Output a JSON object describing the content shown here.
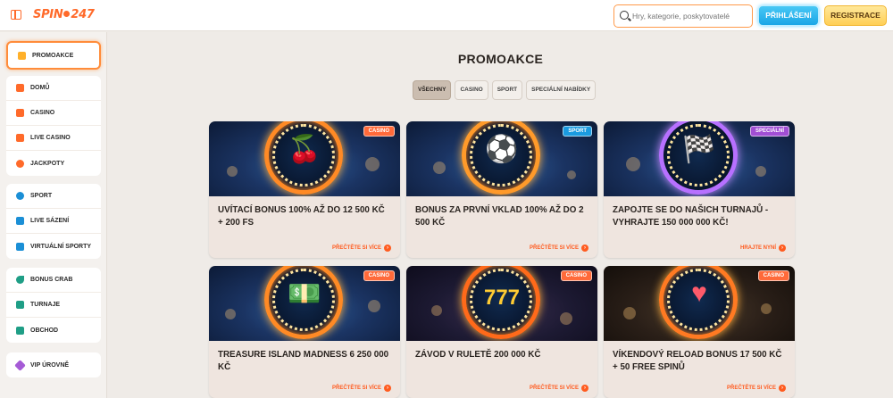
{
  "header": {
    "logo_left": "SPIN",
    "logo_right": "247",
    "search_placeholder": "Hry, kategorie, poskytovatelé",
    "login_label": "PŘIHLÁŠENÍ",
    "register_label": "REGISTRACE"
  },
  "sidebar": {
    "promo": {
      "label": "PROMOAKCE",
      "icon": "gift-icon"
    },
    "group1": [
      {
        "label": "DOMŮ",
        "icon": "home-icon",
        "color": "#ff6a2a"
      },
      {
        "label": "CASINO",
        "icon": "cards-icon",
        "color": "#ff6a2a"
      },
      {
        "label": "LIVE CASINO",
        "icon": "live-casino-icon",
        "color": "#ff6a2a"
      },
      {
        "label": "JACKPOTY",
        "icon": "jackpot-icon",
        "color": "#ff6a2a"
      }
    ],
    "group2": [
      {
        "label": "SPORT",
        "icon": "ball-icon",
        "color": "#1b8fd6"
      },
      {
        "label": "LIVE SÁZENÍ",
        "icon": "live-bet-icon",
        "color": "#1b8fd6"
      },
      {
        "label": "VIRTUÁLNÍ SPORTY",
        "icon": "virtual-sports-icon",
        "color": "#1b8fd6"
      }
    ],
    "group3": [
      {
        "label": "BONUS CRAB",
        "icon": "crab-claw-icon",
        "color": "#1f9e86"
      },
      {
        "label": "TURNAJE",
        "icon": "trophy-icon",
        "color": "#1f9e86"
      },
      {
        "label": "OBCHOD",
        "icon": "shop-icon",
        "color": "#1f9e86"
      }
    ],
    "group4": [
      {
        "label": "VIP ÚROVNĚ",
        "icon": "vip-gem-icon",
        "color": "#a55bd6"
      }
    ]
  },
  "main": {
    "title": "PROMOAKCE",
    "filters": [
      "VŠECHNY",
      "CASINO",
      "SPORT",
      "SPECIÁLNÍ NABÍDKY"
    ],
    "cards": [
      {
        "badge": "CASINO",
        "badge_color": "#ff6a3a",
        "title": "UVÍTACÍ BONUS 100% AŽ DO 12 500 KČ + 200 FS",
        "link": "PŘEČTĚTE SI VÍCE",
        "icon": "cherry-icon"
      },
      {
        "badge": "SPORT",
        "badge_color": "#1b9be0",
        "title": "BONUS ZA PRVNÍ VKLAD 100% AŽ DO 2 500 KČ",
        "link": "PŘEČTĚTE SI VÍCE",
        "icon": "football-icon"
      },
      {
        "badge": "SPECIÁLNÍ",
        "badge_color": "#a14fd4",
        "title": "ZAPOJTE SE DO NAŠICH TURNAJŮ - VYHRAJTE 150 000 000 KČ!",
        "link": "HRAJTE NYNÍ",
        "icon": "race-flags-icon"
      },
      {
        "badge": "CASINO",
        "badge_color": "#ff6a3a",
        "title": "TREASURE ISLAND MADNESS 6 250 000 KČ",
        "link": "PŘEČTĚTE SI VÍCE",
        "icon": "money-stack-icon"
      },
      {
        "badge": "CASINO",
        "badge_color": "#ff6a3a",
        "title": "ZÁVOD V RULETĚ 200 000 KČ",
        "link": "PŘEČTĚTE SI VÍCE",
        "icon": "triple-seven-icon"
      },
      {
        "badge": "CASINO",
        "badge_color": "#ff6a3a",
        "title": "VÍKENDOVÝ RELOAD BONUS 17 500 KČ + 50 FREE SPINŮ",
        "link": "PŘEČTĚTE SI VÍCE",
        "icon": "roulette-icon"
      }
    ]
  }
}
